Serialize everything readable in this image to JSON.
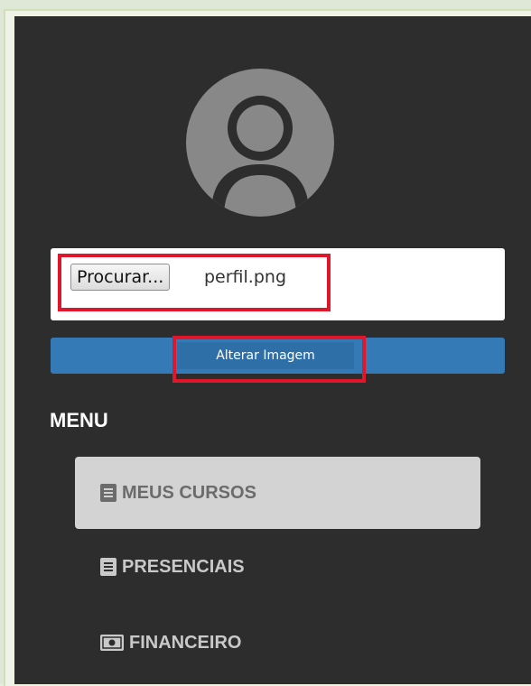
{
  "colors": {
    "sidebar_bg": "#2d2d2d",
    "accent_blue": "#337ab7",
    "highlight_red": "#e0162b",
    "active_item_bg": "#d3d3d3",
    "avatar_gray": "#888888"
  },
  "profile": {
    "avatar_icon": "user-circle-icon",
    "file_input": {
      "browse_label": "Procurar...",
      "file_name": "perfil.png"
    },
    "submit_label": "Alterar Imagem"
  },
  "menu": {
    "heading": "MENU",
    "items": [
      {
        "label": "MEUS CURSOS",
        "icon": "book-icon",
        "active": true
      },
      {
        "label": "PRESENCIAIS",
        "icon": "book-icon",
        "active": false
      },
      {
        "label": "FINANCEIRO",
        "icon": "money-icon",
        "active": false
      }
    ]
  }
}
